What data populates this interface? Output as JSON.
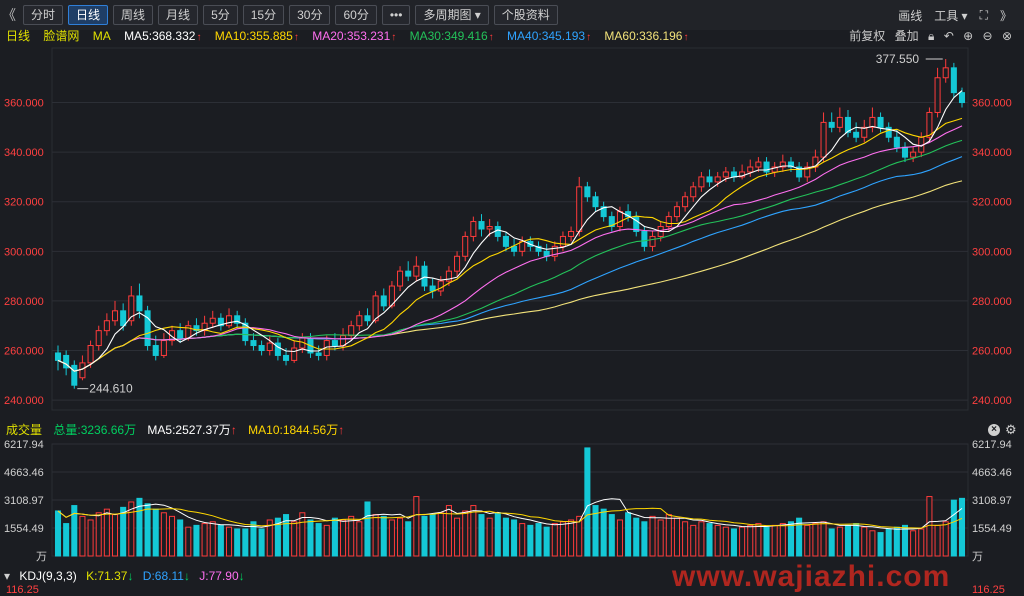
{
  "toolbar": {
    "left_nav": "《",
    "tabs": [
      "分时",
      "日线",
      "周线",
      "月线",
      "5分",
      "15分",
      "30分",
      "60分",
      "•••",
      "多周期图 ▾",
      "个股资料"
    ],
    "active_tab": "日线",
    "right": {
      "draw": "画线",
      "tools": "工具 ▾",
      "fullscreen": "⛶",
      "right_nav": "》"
    }
  },
  "indicator_bar": {
    "period": "日线",
    "name": "脸谱网",
    "ma_label": "MA",
    "ma5": "MA5:368.332",
    "ma10": "MA10:355.885",
    "ma20": "MA20:353.231",
    "ma30": "MA30:349.416",
    "ma40": "MA40:345.193",
    "ma60": "MA60:336.196",
    "up_arrow": "↑",
    "adjust": "前复权",
    "overlay": "叠加"
  },
  "volume_bar": {
    "title": "成交量",
    "total": "总量:3236.66万",
    "ma5": "MA5:2527.37万",
    "ma10": "MA10:1844.56万",
    "up_arrow": "↑"
  },
  "kdj_bar": {
    "title": "KDJ(9,3,3)",
    "k": "K:71.37",
    "d": "D:68.11",
    "j": "J:77.90",
    "down_arrow": "↓",
    "axis_top": "116.25"
  },
  "watermark": "www.wajiazhi.com",
  "colors": {
    "up": "#ff3b3b",
    "down": "#14c8d6",
    "ma5": "#ffffff",
    "ma10": "#ffd700",
    "ma20": "#ff6ff0",
    "ma30": "#23c25a",
    "ma40": "#2fa3ff",
    "ma60": "#f2e27a",
    "vol_ma5": "#ffffff",
    "vol_ma10": "#ffd700",
    "grid": "#2c2f36",
    "axis_text": "#ff4040"
  },
  "chart_data": [
    {
      "type": "candlestick",
      "title": "脸谱网",
      "ylim": [
        236,
        382
      ],
      "yticks": [
        "360.000",
        "340.000",
        "320.000",
        "300.000",
        "280.000",
        "260.000",
        "240.000"
      ],
      "annotations": [
        {
          "text": "377.550",
          "kind": "high"
        },
        {
          "text": "244.610",
          "kind": "low"
        }
      ],
      "candles": [
        [
          259,
          256,
          262,
          252
        ],
        [
          258,
          253,
          260,
          250
        ],
        [
          254,
          246,
          256,
          244.6
        ],
        [
          249,
          255,
          258,
          248
        ],
        [
          255,
          262,
          264,
          253
        ],
        [
          262,
          268,
          270,
          260
        ],
        [
          268,
          272,
          275,
          266
        ],
        [
          272,
          276,
          280,
          270
        ],
        [
          276,
          270,
          279,
          268
        ],
        [
          272,
          282,
          286,
          270
        ],
        [
          282,
          276,
          287,
          273
        ],
        [
          276,
          262,
          278,
          260
        ],
        [
          262,
          258,
          266,
          256
        ],
        [
          258,
          264,
          267,
          257
        ],
        [
          264,
          268,
          270,
          262
        ],
        [
          268,
          265,
          271,
          263
        ],
        [
          265,
          270,
          272,
          264
        ],
        [
          270,
          268,
          273,
          266
        ],
        [
          268,
          271,
          274,
          266
        ],
        [
          271,
          273,
          276,
          269
        ],
        [
          273,
          270,
          275,
          268
        ],
        [
          270,
          274,
          277,
          269
        ],
        [
          274,
          271,
          276,
          269
        ],
        [
          271,
          264,
          273,
          262
        ],
        [
          264,
          262,
          267,
          260
        ],
        [
          262,
          260,
          264,
          258
        ],
        [
          260,
          263,
          266,
          258
        ],
        [
          263,
          258,
          265,
          256
        ],
        [
          258,
          256,
          261,
          254
        ],
        [
          256,
          261,
          264,
          255
        ],
        [
          261,
          265,
          267,
          259
        ],
        [
          265,
          259,
          267,
          257
        ],
        [
          259,
          258,
          262,
          256
        ],
        [
          258,
          264,
          266,
          256
        ],
        [
          264,
          262,
          267,
          260
        ],
        [
          262,
          266,
          269,
          260
        ],
        [
          266,
          270,
          272,
          264
        ],
        [
          270,
          274,
          276,
          268
        ],
        [
          274,
          272,
          277,
          270
        ],
        [
          272,
          282,
          284,
          271
        ],
        [
          282,
          278,
          285,
          276
        ],
        [
          278,
          286,
          288,
          277
        ],
        [
          286,
          292,
          294,
          284
        ],
        [
          292,
          290,
          296,
          288
        ],
        [
          290,
          294,
          298,
          288
        ],
        [
          294,
          286,
          296,
          284
        ],
        [
          286,
          284,
          289,
          281
        ],
        [
          284,
          288,
          290,
          282
        ],
        [
          288,
          292,
          294,
          286
        ],
        [
          292,
          298,
          300,
          290
        ],
        [
          298,
          306,
          308,
          296
        ],
        [
          306,
          312,
          314,
          304
        ],
        [
          312,
          309,
          315,
          306
        ],
        [
          309,
          310,
          313,
          306
        ],
        [
          310,
          306,
          312,
          304
        ],
        [
          306,
          302,
          308,
          300
        ],
        [
          302,
          300,
          305,
          298
        ],
        [
          300,
          304,
          306,
          298
        ],
        [
          304,
          302,
          306,
          300
        ],
        [
          302,
          300,
          304,
          298
        ],
        [
          300,
          298,
          303,
          296
        ],
        [
          298,
          302,
          304,
          296
        ],
        [
          302,
          306,
          308,
          300
        ],
        [
          306,
          308,
          310,
          304
        ],
        [
          308,
          326,
          330,
          306
        ],
        [
          326,
          322,
          328,
          320
        ],
        [
          322,
          318,
          324,
          316
        ],
        [
          318,
          314,
          320,
          312
        ],
        [
          314,
          310,
          316,
          308
        ],
        [
          310,
          316,
          318,
          308
        ],
        [
          316,
          314,
          319,
          312
        ],
        [
          314,
          308,
          316,
          306
        ],
        [
          308,
          302,
          310,
          300
        ],
        [
          302,
          306,
          308,
          300
        ],
        [
          306,
          310,
          312,
          304
        ],
        [
          310,
          314,
          316,
          308
        ],
        [
          314,
          318,
          320,
          312
        ],
        [
          318,
          322,
          324,
          316
        ],
        [
          322,
          326,
          328,
          320
        ],
        [
          326,
          330,
          332,
          324
        ],
        [
          330,
          328,
          333,
          326
        ],
        [
          328,
          330,
          332,
          326
        ],
        [
          330,
          332,
          334,
          328
        ],
        [
          332,
          330,
          334,
          328
        ],
        [
          330,
          332,
          335,
          329
        ],
        [
          332,
          334,
          337,
          330
        ],
        [
          334,
          336,
          338,
          332
        ],
        [
          336,
          332,
          338,
          330
        ],
        [
          332,
          334,
          336,
          330
        ],
        [
          334,
          336,
          339,
          332
        ],
        [
          336,
          334,
          338,
          332
        ],
        [
          334,
          330,
          336,
          328
        ],
        [
          330,
          334,
          336,
          328
        ],
        [
          334,
          338,
          341,
          332
        ],
        [
          338,
          352,
          356,
          336
        ],
        [
          352,
          350,
          356,
          348
        ],
        [
          350,
          354,
          358,
          348
        ],
        [
          354,
          348,
          357,
          346
        ],
        [
          348,
          346,
          352,
          344
        ],
        [
          346,
          350,
          353,
          344
        ],
        [
          350,
          354,
          358,
          348
        ],
        [
          354,
          350,
          356,
          348
        ],
        [
          350,
          346,
          352,
          344
        ],
        [
          346,
          342,
          349,
          340
        ],
        [
          342,
          338,
          344,
          336
        ],
        [
          338,
          340,
          342,
          336
        ],
        [
          340,
          346,
          348,
          338
        ],
        [
          346,
          356,
          358,
          344
        ],
        [
          356,
          370,
          374,
          354
        ],
        [
          370,
          374,
          377.55,
          368
        ],
        [
          374,
          364,
          376,
          362
        ],
        [
          364,
          360,
          366,
          358
        ]
      ]
    },
    {
      "type": "bar",
      "title": "成交量",
      "ylim": [
        0,
        6217.94
      ],
      "yticks": [
        "6217.94",
        "4663.46",
        "3108.97",
        "1554.49"
      ],
      "unit": "万",
      "values": [
        2500,
        1800,
        2800,
        2200,
        2000,
        2400,
        2600,
        2300,
        2700,
        3000,
        3200,
        2900,
        2600,
        2400,
        2200,
        2000,
        1600,
        1700,
        1800,
        1900,
        1700,
        1600,
        1500,
        1500,
        1900,
        1500,
        2000,
        2100,
        2300,
        1900,
        2400,
        2000,
        1800,
        1700,
        2100,
        2000,
        2200,
        1900,
        3000,
        2300,
        2200,
        2000,
        2100,
        1900,
        3300,
        2200,
        2300,
        2400,
        2800,
        2100,
        2500,
        2800,
        2300,
        2100,
        2400,
        2100,
        2000,
        1800,
        1700,
        1800,
        1600,
        1800,
        1900,
        2000,
        2200,
        6000,
        2800,
        2600,
        2300,
        2000,
        2400,
        2100,
        1900,
        2200,
        2000,
        2300,
        2100,
        1900,
        1700,
        1900,
        1800,
        1700,
        1600,
        1500,
        1600,
        1700,
        1800,
        1600,
        1700,
        1800,
        1900,
        2100,
        1700,
        1800,
        1900,
        1500,
        1600,
        1700,
        1800,
        1600,
        1400,
        1300,
        1500,
        1600,
        1700,
        1400,
        1500,
        3300,
        1700,
        1900,
        3100,
        3200
      ]
    }
  ]
}
